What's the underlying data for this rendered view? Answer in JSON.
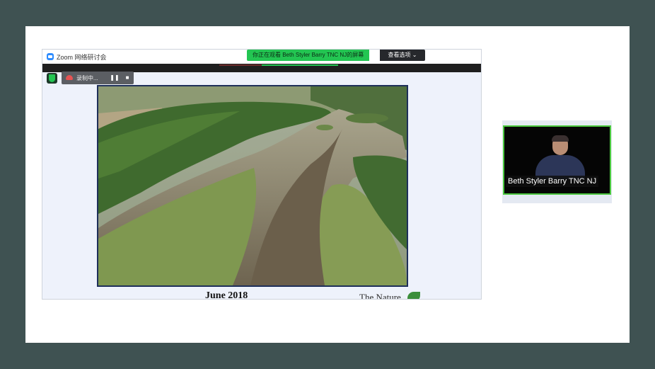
{
  "window": {
    "title": "Zoom 网络研讨会"
  },
  "sharing": {
    "banner": "你正在观看 Beth Styler Barry  TNC NJ的屏幕",
    "view_options": "查看选项 ⌄"
  },
  "recording": {
    "label": "录制中...",
    "pause_glyph": "❚❚",
    "stop_glyph": "■"
  },
  "slide": {
    "caption": "June 2018",
    "logo_text": "The Nature"
  },
  "participant": {
    "name": "Beth Styler Barry  TNC NJ"
  },
  "colors": {
    "background": "#3f5252",
    "share_green": "#23c552",
    "active_speaker_border": "#4cc83f",
    "slide_border": "#1e2f5a"
  },
  "icons": [
    "zoom-logo-icon",
    "shield-icon",
    "cloud-record-icon",
    "pause-icon",
    "stop-icon",
    "leaf-icon"
  ]
}
